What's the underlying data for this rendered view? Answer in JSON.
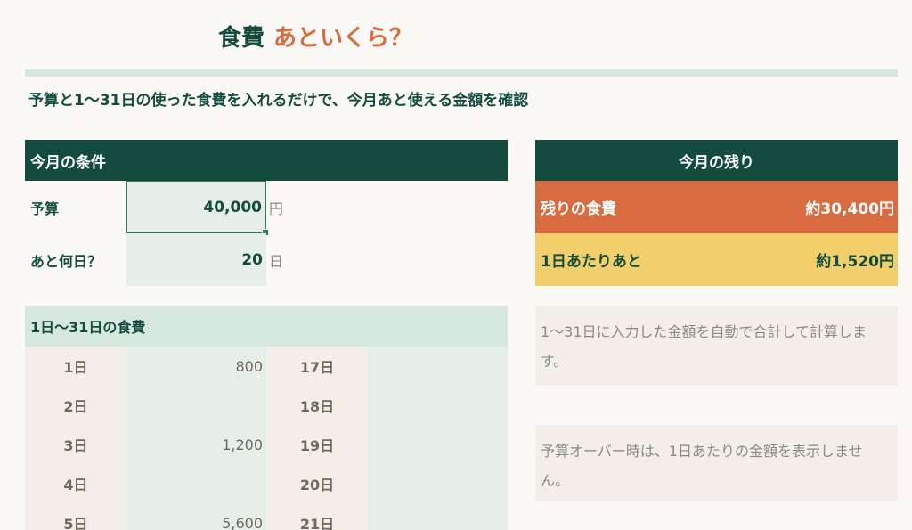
{
  "title": {
    "main": "食費",
    "accent": "あといくら？"
  },
  "subtitle": "予算と1〜31日の使った食費を入れるだけで、今月あと使える金額を確認",
  "conditions": {
    "header": "今月の条件",
    "budget_label": "予算",
    "budget_value": "40,000",
    "budget_unit": "円",
    "days_label": "あと何日？",
    "days_value": "20",
    "days_unit": "日"
  },
  "daily": {
    "header": "1日〜31日の食費",
    "rows": [
      {
        "day": "1日",
        "amount": "800",
        "day2": "17日",
        "amount2": ""
      },
      {
        "day": "2日",
        "amount": "",
        "day2": "18日",
        "amount2": ""
      },
      {
        "day": "3日",
        "amount": "1,200",
        "day2": "19日",
        "amount2": ""
      },
      {
        "day": "4日",
        "amount": "",
        "day2": "20日",
        "amount2": ""
      },
      {
        "day": "5日",
        "amount": "5,600",
        "day2": "21日",
        "amount2": ""
      }
    ]
  },
  "remaining": {
    "header": "今月の残り",
    "food_left_label": "残りの食費",
    "food_left_value": "約30,400円",
    "per_day_label": "1日あたりあと",
    "per_day_value": "約1,520円"
  },
  "notes": {
    "note1": "1〜31日に入力した金額を自動で合計して計算します。",
    "note2": "予算オーバー時は、1日あたりの金額を表示しません。"
  },
  "colors": {
    "dark_green": "#134c3e",
    "orange": "#d86b40",
    "yellow": "#f2cf6b",
    "light_green": "#d6e7dd",
    "input_green": "#e5efe8",
    "beige": "#f3efe8"
  }
}
